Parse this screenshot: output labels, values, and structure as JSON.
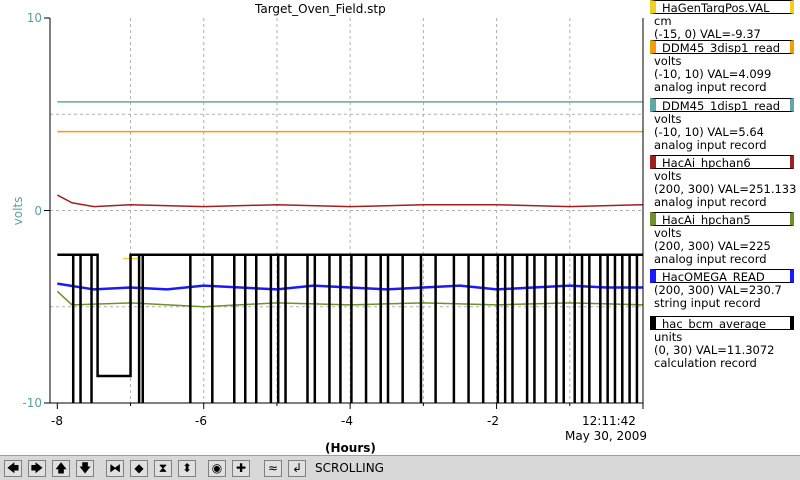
{
  "plot": {
    "title": "Target_Oven_Field.stp",
    "y_axis_label": "volts",
    "y_ticks": [
      "10",
      "0",
      "-10"
    ],
    "x_ticks": [
      "-8",
      "-6",
      "-4",
      "-2"
    ],
    "x_axis_label": "(Hours)",
    "time_label": "12:11:42",
    "date_label": "May 30, 2009",
    "grid": true
  },
  "chart_data": {
    "type": "line",
    "x_unit": "Hours",
    "xlim": [
      -8.1,
      0
    ],
    "ylim": [
      -10,
      10
    ],
    "series": [
      {
        "name": "HaGenTargPos.VAL",
        "color": "#f0d020",
        "x": [
          -7.1,
          -6.9
        ],
        "y": [
          -2.5,
          -2.5
        ]
      },
      {
        "name": "DDM45_3disp1_read",
        "color": "#f0a000",
        "x": [
          -8,
          0
        ],
        "y": [
          4.1,
          4.1
        ]
      },
      {
        "name": "DDM45_1disp1_read",
        "color": "#60a8a8",
        "x": [
          -8,
          0
        ],
        "y": [
          5.64,
          5.64
        ]
      },
      {
        "name": "HacAi_hpchan6",
        "color": "#a02020",
        "x": [
          -8,
          -7.8,
          -7.5,
          -7,
          -6,
          -5,
          -4,
          -3,
          -2,
          -1,
          0
        ],
        "y": [
          0.8,
          0.4,
          0.2,
          0.3,
          0.2,
          0.3,
          0.2,
          0.3,
          0.3,
          0.2,
          0.3
        ]
      },
      {
        "name": "HacAi_hpchan5",
        "color": "#70902a",
        "x": [
          -8,
          -7.8,
          -7,
          -6,
          -5,
          -4,
          -3,
          -2,
          -1,
          0
        ],
        "y": [
          -4.2,
          -4.9,
          -4.8,
          -5.0,
          -4.8,
          -4.9,
          -4.8,
          -4.9,
          -4.8,
          -4.9
        ]
      },
      {
        "name": "HacOMEGA_READ",
        "color": "#1a1aff",
        "x": [
          -8,
          -7.5,
          -7,
          -6.5,
          -6,
          -5.5,
          -5,
          -4.5,
          -4,
          -3.5,
          -3,
          -2.5,
          -2,
          -1.5,
          -1,
          -0.5,
          0
        ],
        "y": [
          -3.8,
          -4.1,
          -4.0,
          -4.1,
          -3.9,
          -4.0,
          -4.1,
          -3.9,
          -4.0,
          -4.1,
          -4.0,
          -3.9,
          -4.1,
          -4.0,
          -3.9,
          -4.0,
          -4.0
        ]
      },
      {
        "name": "hac_bcm_average",
        "color": "#000000",
        "x": [
          -8,
          -7.45,
          -7.45,
          -7.0,
          -7.0,
          -6.0,
          -5.0,
          -4.0,
          -3.0,
          -2.0,
          -1.0,
          0
        ],
        "y": [
          -2.3,
          -2.3,
          -8.6,
          -8.6,
          -2.3,
          -2.3,
          -2.3,
          -2.3,
          -2.3,
          -2.3,
          -2.3,
          -2.3
        ]
      }
    ]
  },
  "legend": [
    {
      "name": "HaGenTargPos.VAL",
      "color": "#f0d020",
      "lines": [
        "cm",
        "(-15, 0) VAL=-9.37"
      ]
    },
    {
      "name": "DDM45_3disp1_read",
      "color": "#f0a000",
      "lines": [
        "volts",
        "(-10, 10) VAL=4.099",
        "analog input record"
      ]
    },
    {
      "name": "DDM45_1disp1_read",
      "color": "#60a8a8",
      "lines": [
        "volts",
        "(-10, 10) VAL=5.64",
        "analog input record"
      ]
    },
    {
      "name": "HacAi_hpchan6",
      "color": "#a02020",
      "lines": [
        "volts",
        "(200, 300) VAL=251.133",
        "analog input record"
      ]
    },
    {
      "name": "HacAi_hpchan5",
      "color": "#70902a",
      "lines": [
        "volts",
        "(200, 300) VAL=225",
        "analog input record"
      ]
    },
    {
      "name": "HacOMEGA_READ",
      "color": "#1a1aff",
      "lines": [
        "(200, 300) VAL=230.7",
        "string input record"
      ]
    },
    {
      "name": "hac_bcm_average",
      "color": "#000000",
      "lines": [
        "units",
        "(0, 30) VAL=11.3072",
        "calculation record"
      ]
    }
  ],
  "toolbar": {
    "buttons": [
      {
        "icon": "arrow-left-icon",
        "glyph": "🡄"
      },
      {
        "icon": "arrow-right-icon",
        "glyph": "🡆"
      },
      {
        "icon": "arrow-up-icon",
        "glyph": "🡅"
      },
      {
        "icon": "arrow-down-icon",
        "glyph": "🡇"
      },
      {
        "icon": "zoom-in-horizontal-icon",
        "glyph": "⧓"
      },
      {
        "icon": "zoom-out-horizontal-icon",
        "glyph": "◆"
      },
      {
        "icon": "zoom-in-vertical-icon",
        "glyph": "⧗"
      },
      {
        "icon": "zoom-out-vertical-icon",
        "glyph": "⬍"
      },
      {
        "icon": "center-icon",
        "glyph": "◉"
      },
      {
        "icon": "add-icon",
        "glyph": "✚"
      },
      {
        "icon": "scroll-icon",
        "glyph": "≈"
      },
      {
        "icon": "return-icon",
        "glyph": "↲"
      }
    ],
    "status": "SCROLLING"
  }
}
